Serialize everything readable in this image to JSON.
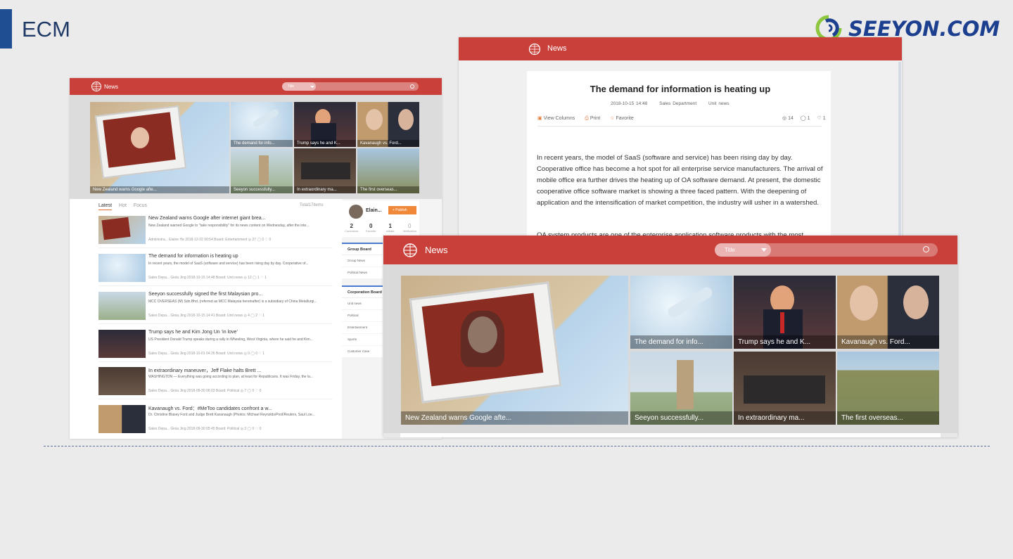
{
  "slide": {
    "title": "ECM",
    "logo_text": "SEEYON.COM"
  },
  "colors": {
    "brand_red": "#c9403a",
    "accent_orange": "#f0883a",
    "navy": "#1f4e92"
  },
  "left": {
    "header": {
      "brand": "News",
      "search_select": "Title"
    },
    "gallery": [
      {
        "caption": "New Zealand warns Google afte..."
      },
      {
        "caption": "The demand for info..."
      },
      {
        "caption": "Trump says he and K..."
      },
      {
        "caption": "Kavanaugh vs. Ford..."
      },
      {
        "caption": "Seeyon successfully..."
      },
      {
        "caption": "In extraordinary ma..."
      },
      {
        "caption": "The first overseas..."
      }
    ],
    "tabs": [
      "Latest",
      "Hot",
      "Focus"
    ],
    "total": "Total17items",
    "rows": [
      {
        "title": "New Zealand warns Google after internet giant brea...",
        "summary": "New Zealand warned Google to \"take responsibility\" for its news content on Wednesday, after the inte...",
        "meta": "Administra...   Elaine He   2018-12-22 00:54   Board: Entertainment      ◎ 27     ◯ 0     ♡ 0"
      },
      {
        "title": "The demand for information is heating up",
        "summary": "In recent years, the model of SaaS (software and service) has been rising day by day. Cooperative of...",
        "meta": "Sales Depa...   Gioia Jing   2018-10-15 14:48   Board: Unit news      ◎ 12     ◯ 1     ♡ 1"
      },
      {
        "title": "Seeyon successfully signed the first Malaysian pro...",
        "summary": "MCC OVERSEAS (M) Sdn.Bhd, (referred as MCC Malaysia hereinafter) is a subsidiary of China Metallurgi...",
        "meta": "Sales Depa...   Gioia Jing   2018-10-15 14:41   Board: Unit news      ◎ 4     ◯ 2     ♡ 1"
      },
      {
        "title": "Trump says he and Kim Jong Un ‘in love’",
        "summary": "US President Donald Trump speaks during a rally in Wheeling, West Virginia, where he said he and Kim...",
        "meta": "Sales Depa...   Gioia Jing   2018-10-01 04:26   Board: Unit news      ◎ 0     ◯ 0     ♡ 1"
      },
      {
        "title": "In extraordinary maneuver，Jeff Flake halts Brett ...",
        "summary": "WASHINGTON — Everything was going according to plan, at least for Republicans. It was Friday, the la...",
        "meta": "Sales Depa...   Gioia Jing   2018-09-30 06:03   Board: Political      ◎ 7     ◯ 0     ♡ 0"
      },
      {
        "title": "Kavanaugh vs. Ford：#MeToo candidates confront a w...",
        "summary": "Dr. Christine Blasey Ford and Judge Brett Kavanaugh (Photos: Michael Reynolds/Pool/Reuters, Saul Loe...",
        "meta": "Sales Depa...   Gioia Jing   2018-09-30 05:45   Board: Political      ◎ 3     ◯ 0     ♡ 0"
      }
    ],
    "user": {
      "name": "Elain...",
      "publish": "+ Publish"
    },
    "stats": [
      {
        "value": "2",
        "label": "Comments"
      },
      {
        "value": "0",
        "label": "Favorite"
      },
      {
        "value": "1",
        "label": "Initiate"
      },
      {
        "value": "0",
        "label": "Verification"
      }
    ],
    "group_board": {
      "title": "Group Board",
      "items": [
        "Group News",
        "Political News"
      ]
    },
    "corporation_board": {
      "title": "Corporation Board",
      "items": [
        "Unit news",
        "Political",
        "Entertainment",
        "Sports",
        "Customer Case"
      ]
    }
  },
  "article": {
    "brand": "News",
    "title": "The demand for information is heating up",
    "date": "2018-10-15 14:48",
    "department": "Sales Department",
    "board": "Unit news",
    "tools": {
      "view_columns": "View Columns",
      "print": "Print",
      "favorite": "Favorite"
    },
    "counts": {
      "views": "14",
      "comments": "1",
      "likes": "1"
    },
    "paragraph1": "In recent years, the model of SaaS (software and service) has been rising day by day. Cooperative office has become a hot spot for all enterprise service manufacturers. The arrival of mobile office era further drives the heating up of OA software demand. At present, the domestic cooperative office software market is showing a three faced pattern. With the deepening of application and the intensification of market competition, the industry will usher in a watershed.",
    "paragraph2": "OA system products are one of the enterprise application software products with the most"
  },
  "front": {
    "brand": "News",
    "search_select": "Title",
    "gallery": [
      {
        "caption": "New Zealand warns Google afte..."
      },
      {
        "caption": "The demand for info..."
      },
      {
        "caption": "Trump says he and K..."
      },
      {
        "caption": "Kavanaugh vs. Ford..."
      },
      {
        "caption": "Seeyon successfully..."
      },
      {
        "caption": "In extraordinary ma..."
      },
      {
        "caption": "The first overseas..."
      }
    ]
  }
}
